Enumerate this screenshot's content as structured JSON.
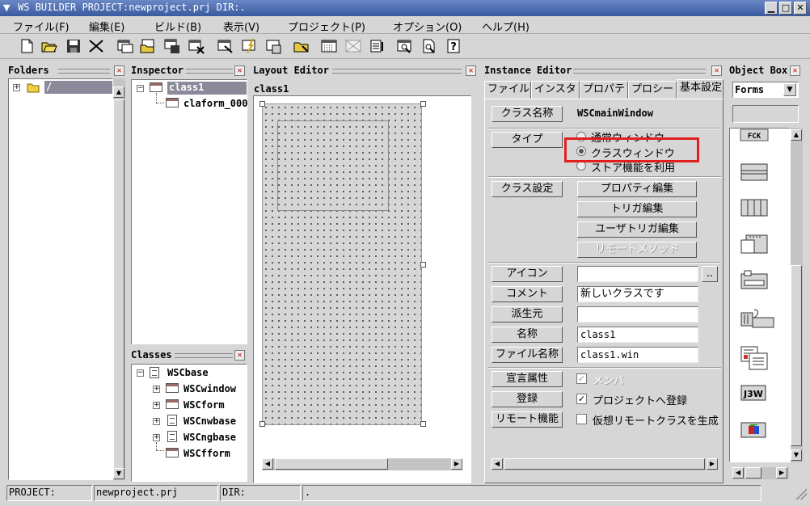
{
  "window": {
    "title": "WS BUILDER PROJECT:newproject.prj DIR:.",
    "minimize": "▁",
    "maximize": "□",
    "close": "✕"
  },
  "menu": [
    "ファイル(F)",
    "編集(E)",
    "ビルド(B)",
    "表示(V)",
    "プロジェクト(P)",
    "オプション(O)",
    "ヘルプ(H)"
  ],
  "toolbar": [
    "new-file-icon",
    "open-folder-icon",
    "save-icon",
    "cut-icon",
    "new-class-icon",
    "open-class-icon",
    "save-class-icon",
    "close-class-icon",
    "edit-icon",
    "build-icon",
    "run-icon",
    "folder-icon",
    "grid-icon",
    "layout-icon",
    "list-icon",
    "find-icon",
    "preview-icon",
    "help-icon"
  ],
  "folders": {
    "title": "Folders",
    "root": "/"
  },
  "inspector": {
    "title": "Inspector",
    "items": [
      "class1",
      "claform_000"
    ]
  },
  "classes": {
    "title": "Classes",
    "root": "WSCbase",
    "children": [
      {
        "label": "WSCwindow",
        "icon": "window-icon"
      },
      {
        "label": "WSCform",
        "icon": "window-icon"
      },
      {
        "label": "WSCnwbase",
        "icon": "document-icon"
      },
      {
        "label": "WSCngbase",
        "icon": "document-icon"
      },
      {
        "label": "WSCfform",
        "icon": "window-icon"
      }
    ]
  },
  "layout_editor": {
    "title": "Layout Editor",
    "canvas_title": "class1"
  },
  "instance_editor": {
    "title": "Instance Editor",
    "tabs": [
      "ファイル",
      "インスタ",
      "プロパテ",
      "プロシー",
      "基本設定"
    ],
    "active_tab": 4,
    "class_name_button": "クラス名称",
    "class_name_value": "WSCmainWindow",
    "type_button": "タイプ",
    "type_options": [
      "通常ウィンドウ",
      "クラスウィンドウ",
      "ストア機能を利用"
    ],
    "type_selected": 1,
    "class_settings_button": "クラス設定",
    "property_edit": "プロパティ編集",
    "trigger_edit": "トリガ編集",
    "user_trigger_edit": "ユーザトリガ編集",
    "remote_method": "リモートメソッド",
    "icon_button": "アイコン",
    "icon_value": "",
    "browse_button": "..",
    "comment_button": "コメント",
    "comment_value": "新しいクラスです",
    "derived_button": "派生元",
    "derived_value": "",
    "name_button": "名称",
    "name_value": "class1",
    "filename_button": "ファイル名称",
    "filename_value": "class1.win",
    "declare_button": "宣言属性",
    "declare_check": "メンバ",
    "register_button": "登録",
    "register_check": "プロジェクトへ登録",
    "remote_button": "リモート機能",
    "remote_check": "仮想リモートクラスを生成"
  },
  "object_box": {
    "title": "Object Box",
    "category": "Forms",
    "items": [
      "fck-icon",
      "panel-icon",
      "column-list-icon",
      "tab-form-icon",
      "label-frame-icon",
      "scroll-form-icon",
      "document-form-icon",
      "j3w-icon",
      "color-cube-icon"
    ],
    "j3w_label": "J3W",
    "fck_label": "FCK"
  },
  "status": {
    "project_label": "PROJECT:",
    "project_value": "newproject.prj",
    "dir_label": "DIR:",
    "dir_value": "."
  },
  "colors": {
    "highlight": "#e02020",
    "selection": "#8a8a9a"
  }
}
